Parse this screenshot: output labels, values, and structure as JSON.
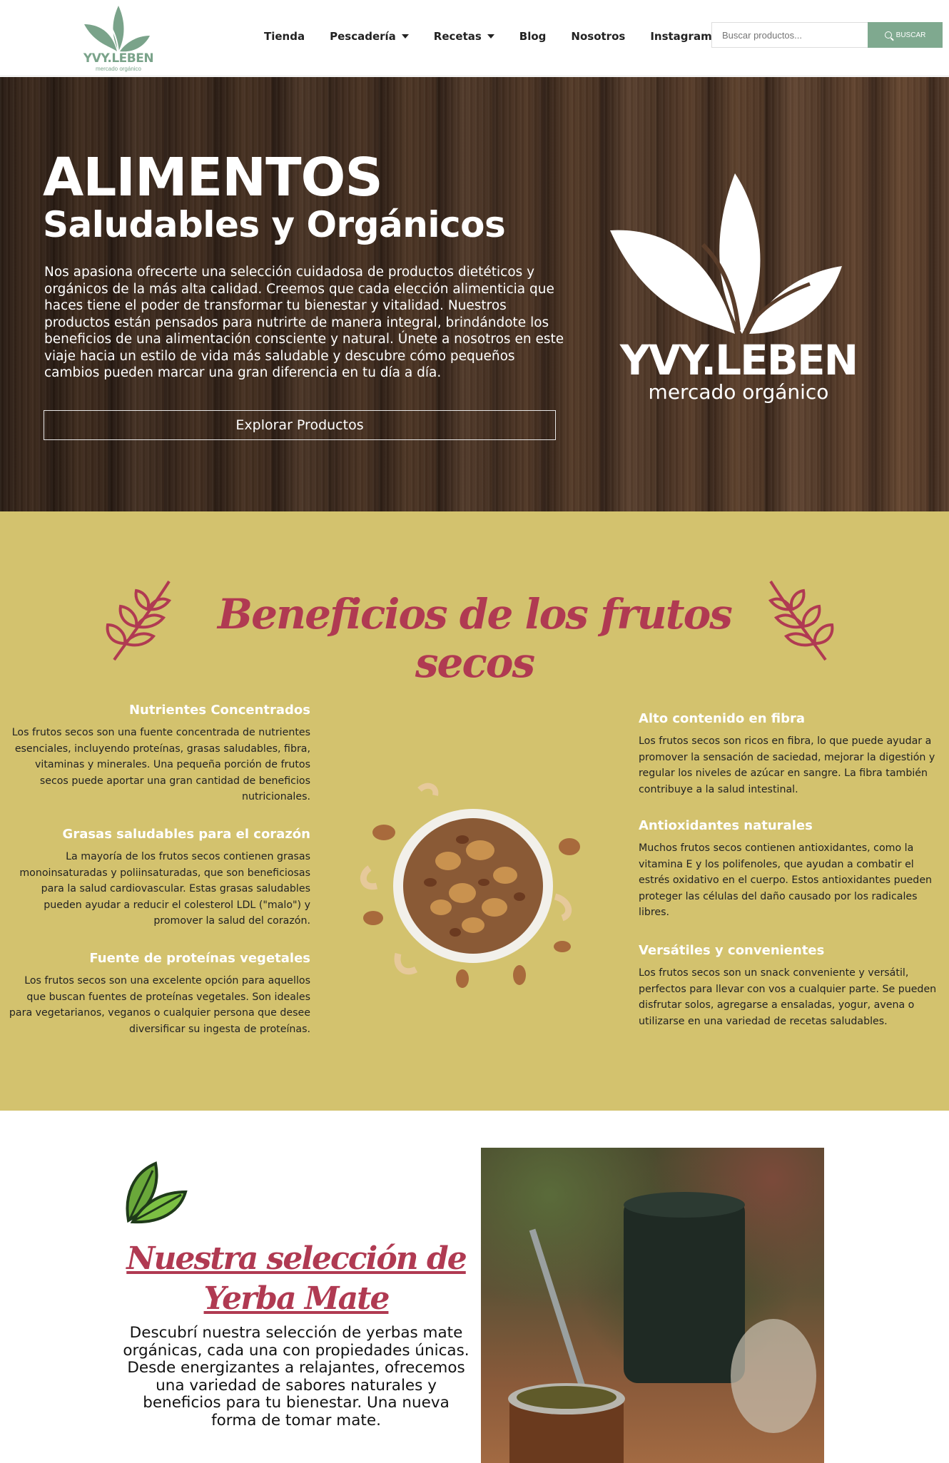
{
  "header": {
    "logo_text": "YVY.LEBEN",
    "logo_sub": "mercado orgánico",
    "nav": [
      {
        "label": "Tienda",
        "dropdown": false
      },
      {
        "label": "Pescadería",
        "dropdown": true
      },
      {
        "label": "Recetas",
        "dropdown": true
      },
      {
        "label": "Blog",
        "dropdown": false
      },
      {
        "label": "Nosotros",
        "dropdown": false
      },
      {
        "label": "Instagram",
        "dropdown": false
      }
    ],
    "search_placeholder": "Buscar productos...",
    "search_button": "BUSCAR"
  },
  "hero": {
    "title": "ALIMENTOS",
    "subtitle": "Saludables y Orgánicos",
    "text": "Nos apasiona ofrecerte una selección cuidadosa de productos dietéticos y orgánicos de la más alta calidad. Creemos que cada elección alimenticia que haces tiene el poder de transformar tu bienestar y vitalidad. Nuestros productos están pensados para nutrirte de manera integral, brindándote los beneficios de una alimentación consciente y natural. Únete a nosotros en este viaje hacia un estilo de vida más saludable y descubre cómo pequeños cambios pueden marcar una gran diferencia en tu día a día.",
    "button": "Explorar Productos",
    "logo_text": "YVY.LEBEN",
    "logo_sub": "mercado orgánico"
  },
  "benefits": {
    "title": "Beneficios de los frutos secos",
    "left": [
      {
        "heading": "Nutrientes Concentrados",
        "text": "Los frutos secos son una fuente concentrada de nutrientes esenciales, incluyendo proteínas, grasas saludables, fibra, vitaminas y minerales. Una pequeña porción de frutos secos puede aportar una gran cantidad de beneficios nutricionales."
      },
      {
        "heading": "Grasas saludables para el corazón",
        "text": "La mayoría de los frutos secos contienen grasas monoinsaturadas y poliinsaturadas, que son beneficiosas para la salud cardiovascular. Estas grasas saludables pueden ayudar a reducir el colesterol LDL (\"malo\") y promover la salud del corazón."
      },
      {
        "heading": "Fuente de proteínas vegetales",
        "text": "Los frutos secos son una excelente opción para aquellos que buscan fuentes de proteínas vegetales. Son ideales para vegetarianos, veganos o cualquier persona que desee diversificar su ingesta de proteínas."
      }
    ],
    "right": [
      {
        "heading": "Alto contenido en fibra",
        "text": "Los frutos secos son ricos en fibra, lo que puede ayudar a promover la sensación de saciedad, mejorar la digestión y regular los niveles de azúcar en sangre. La fibra también contribuye a la salud intestinal."
      },
      {
        "heading": "Antioxidantes naturales",
        "text": "Muchos frutos secos contienen antioxidantes, como la vitamina E y los polifenoles, que ayudan a combatir el estrés oxidativo en el cuerpo. Estos antioxidantes pueden proteger las células del daño causado por los radicales libres."
      },
      {
        "heading": "Versátiles y convenientes",
        "text": "Los frutos secos son un snack conveniente y versátil, perfectos para llevar con vos a cualquier parte. Se pueden disfrutar solos, agregarse a ensaladas, yogur, avena o utilizarse en una variedad de recetas saludables."
      }
    ]
  },
  "yerba": {
    "title": "Nuestra selección de Yerba Mate",
    "text": "Descubrí nuestra selección de yerbas mate orgánicas, cada una con propiedades únicas. Desde energizantes a relajantes, ofrecemos una variedad de sabores naturales y beneficios para tu bienestar. Una nueva forma de tomar mate."
  },
  "colors": {
    "accent_green": "#7fa98f",
    "mustard": "#d3c26e",
    "title_red": "#b03a52"
  }
}
